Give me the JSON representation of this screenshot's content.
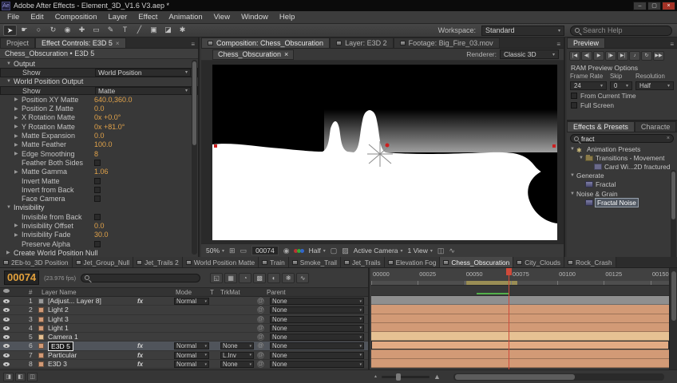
{
  "ui": {
    "caret": "▾",
    "caret_big": "▼",
    "menu": "≡",
    "close": "×",
    "pickwhip": "@",
    "mountain": "▲"
  },
  "colors": {
    "value_text": "#e0a24a",
    "layer_bar": "#d29a76",
    "camera_bar": "#e6c193",
    "adjustment_bar": "#8f8f8f",
    "cti": "#d04a3a",
    "cached": "#53b04a"
  },
  "titlebar": {
    "title": "Adobe After Effects - Element_3D_V1.6 V3.aep *",
    "app_initials": "Ae",
    "minimize": "–",
    "maximize": "▢",
    "close": "×"
  },
  "menubar": {
    "items": [
      "File",
      "Edit",
      "Composition",
      "Layer",
      "Effect",
      "Animation",
      "View",
      "Window",
      "Help"
    ]
  },
  "toolbar": {
    "tools": [
      {
        "name": "selection-tool-icon",
        "glyph": "➤"
      },
      {
        "name": "hand-tool-icon",
        "glyph": "☛"
      },
      {
        "name": "zoom-tool-icon",
        "glyph": "○"
      },
      {
        "name": "rotation-tool-icon",
        "glyph": "↻"
      },
      {
        "name": "unified-camera-tool-icon",
        "glyph": "◉"
      },
      {
        "name": "pan-behind-tool-icon",
        "glyph": "✚"
      },
      {
        "name": "mask-shape-tool-icon",
        "glyph": "▭"
      },
      {
        "name": "pen-tool-icon",
        "glyph": "✎"
      },
      {
        "name": "type-tool-icon",
        "glyph": "T"
      },
      {
        "name": "brush-tool-icon",
        "glyph": "╱"
      },
      {
        "name": "clone-stamp-tool-icon",
        "glyph": "▣"
      },
      {
        "name": "eraser-tool-icon",
        "glyph": "◪"
      },
      {
        "name": "puppet-pin-tool-icon",
        "glyph": "✱"
      }
    ],
    "workspace_label": "Workspace:",
    "workspace_value": "Standard",
    "search_placeholder": "Search Help"
  },
  "effect_controls": {
    "tab_project": "Project",
    "tab_active": "Effect Controls: E3D 5",
    "breadcrumb": "Chess_Obscuration • E3D 5",
    "rows": [
      {
        "label": "Output",
        "type": "group",
        "ind": "i0",
        "twirl": "▼",
        "value": ""
      },
      {
        "label": "Show",
        "type": "dropdown",
        "ind": "i1",
        "twirl": "",
        "value": "World Position"
      },
      {
        "label": "World Position Output",
        "type": "group",
        "ind": "i0",
        "twirl": "▼",
        "value": ""
      },
      {
        "label": "Show",
        "type": "dropdown",
        "ind": "i1",
        "twirl": "",
        "value": "Matte"
      },
      {
        "label": "Position XY Matte",
        "type": "value",
        "ind": "i1",
        "twirl": "▶",
        "value": "640.0,360.0"
      },
      {
        "label": "Position Z Matte",
        "type": "value",
        "ind": "i1",
        "twirl": "▶",
        "value": "0.0"
      },
      {
        "label": "X Rotation Matte",
        "type": "value",
        "ind": "i1",
        "twirl": "▶",
        "value": "0x +0.0°"
      },
      {
        "label": "Y Rotation Matte",
        "type": "value",
        "ind": "i1",
        "twirl": "▶",
        "value": "0x +81.0°"
      },
      {
        "label": "Matte Expansion",
        "type": "value",
        "ind": "i1",
        "twirl": "▶",
        "value": "0.0"
      },
      {
        "label": "Matte Feather",
        "type": "value",
        "ind": "i1",
        "twirl": "▶",
        "value": "100.0"
      },
      {
        "label": "Edge Smoothing",
        "type": "value",
        "ind": "i1",
        "twirl": "▶",
        "value": "8"
      },
      {
        "label": "Feather Both Sides",
        "type": "check",
        "ind": "i1",
        "twirl": "",
        "value": ""
      },
      {
        "label": "Matte Gamma",
        "type": "value",
        "ind": "i1",
        "twirl": "▶",
        "value": "1.06"
      },
      {
        "label": "Invert Matte",
        "type": "check",
        "ind": "i1",
        "twirl": "",
        "value": ""
      },
      {
        "label": "Invert from Back",
        "type": "check",
        "ind": "i1",
        "twirl": "",
        "value": ""
      },
      {
        "label": "Face Camera",
        "type": "check",
        "ind": "i1",
        "twirl": "",
        "value": ""
      },
      {
        "label": "Invisibility",
        "type": "group",
        "ind": "i0",
        "twirl": "▼",
        "value": ""
      },
      {
        "label": "Invisible from Back",
        "type": "check",
        "ind": "i1",
        "twirl": "",
        "value": ""
      },
      {
        "label": "Invisibility Offset",
        "type": "value",
        "ind": "i1",
        "twirl": "▶",
        "value": "0.0"
      },
      {
        "label": "Invisibility Fade",
        "type": "value",
        "ind": "i1",
        "twirl": "▶",
        "value": "30.0"
      },
      {
        "label": "Preserve Alpha",
        "type": "check",
        "ind": "i1",
        "twirl": "",
        "value": ""
      },
      {
        "label": "Create World Position Null",
        "type": "group",
        "ind": "i0",
        "twirl": "▶",
        "value": ""
      }
    ]
  },
  "composition": {
    "tabs": [
      {
        "label": "Composition: Chess_Obscuration",
        "active": "on"
      },
      {
        "label": "Layer: E3D 2",
        "active": ""
      },
      {
        "label": "Footage: Big_Fire_03.mov",
        "active": ""
      }
    ],
    "viewer_tab": "Chess_Obscuration",
    "renderer_label": "Renderer:",
    "renderer_value": "Classic 3D",
    "bottom": {
      "zoom": "50%",
      "grid_icon": "⊞",
      "mask_icon": "▭",
      "timecode": "00074",
      "snapshot_icon": "◉",
      "resolution": "Half",
      "roi_icon": "▢",
      "transparency_icon": "▨",
      "camera": "Active Camera",
      "views": "1 View",
      "pixel_aspect_icon": "◫",
      "fast_preview_icon": "∿"
    }
  },
  "preview": {
    "tab": "Preview",
    "buttons": [
      {
        "name": "first-frame-button",
        "glyph": "|◀"
      },
      {
        "name": "previous-frame-button",
        "glyph": "◀|"
      },
      {
        "name": "play-button",
        "glyph": "▶"
      },
      {
        "name": "next-frame-button",
        "glyph": "|▶"
      },
      {
        "name": "last-frame-button",
        "glyph": "▶|"
      },
      {
        "name": "audio-button",
        "glyph": "♪"
      },
      {
        "name": "loop-button",
        "glyph": "↻"
      },
      {
        "name": "ram-preview-button",
        "glyph": "▶▶"
      }
    ],
    "options_title": "RAM Preview Options",
    "frame_rate_label": "Frame Rate",
    "frame_rate_value": "24",
    "skip_label": "Skip",
    "skip_value": "0",
    "resolution_label": "Resolution",
    "resolution_value": "Half",
    "from_current_time_label": "From Current Time",
    "full_screen_label": "Full Screen"
  },
  "effects_presets": {
    "tab": "Effects & Presets",
    "tab_partial": "Characte",
    "search_value": "fract",
    "tree": [
      {
        "label": "Animation Presets",
        "ind": "t0",
        "twirl": "▼",
        "icon": "presets",
        "sel": ""
      },
      {
        "label": "Transitions - Movement",
        "ind": "t1",
        "twirl": "▼",
        "icon": "folder",
        "sel": ""
      },
      {
        "label": "Card Wi...2D fractured",
        "ind": "t2",
        "twirl": "",
        "icon": "preset",
        "sel": ""
      },
      {
        "label": "Generate",
        "ind": "t0",
        "twirl": "▼",
        "icon": "none",
        "sel": ""
      },
      {
        "label": "Fractal",
        "ind": "t1",
        "twirl": "",
        "icon": "effect",
        "sel": ""
      },
      {
        "label": "Noise & Grain",
        "ind": "t0",
        "twirl": "▼",
        "icon": "none",
        "sel": ""
      },
      {
        "label": "Fractal Noise",
        "ind": "t1",
        "twirl": "",
        "icon": "effect",
        "sel": "sel"
      }
    ]
  },
  "comp_tabs": {
    "items": [
      {
        "label": "2Eb-to_3D Position",
        "active": ""
      },
      {
        "label": "Jet_Group_Null",
        "active": ""
      },
      {
        "label": "Jet_Trails 2",
        "active": ""
      },
      {
        "label": "World Position Matte",
        "active": ""
      },
      {
        "label": "Train",
        "active": ""
      },
      {
        "label": "Smoke_Trail",
        "active": ""
      },
      {
        "label": "Jet_Trails",
        "active": ""
      },
      {
        "label": "Elevation Fog",
        "active": ""
      },
      {
        "label": "Chess_Obscuration",
        "active": "on"
      },
      {
        "label": "City_Clouds",
        "active": ""
      },
      {
        "label": "Rock_Crash",
        "active": ""
      }
    ]
  },
  "timeline": {
    "timecode": "00074",
    "fps": "(23.976 fps)",
    "headers": {
      "number": "#",
      "layer_name": "Layer Name",
      "mode": "Mode",
      "t": "T",
      "trkmat": "TrkMat",
      "parent": "Parent"
    },
    "view_icons": [
      {
        "name": "comp-mini-flowchart-icon",
        "glyph": "◱"
      },
      {
        "name": "draft-3d-icon",
        "glyph": "▦"
      },
      {
        "name": "hide-shy-layers-icon",
        "glyph": "◔"
      },
      {
        "name": "frame-blending-icon",
        "glyph": "▩"
      },
      {
        "name": "motion-blur-icon",
        "glyph": "◐"
      },
      {
        "name": "brainstorm-icon",
        "glyph": "❋"
      },
      {
        "name": "graph-editor-icon",
        "glyph": "∿"
      }
    ],
    "layers": [
      {
        "num": "1",
        "name": "[Adjust... Layer 8]",
        "mode": "Normal",
        "mode_vis": "show",
        "trkmat": "",
        "trkmat_vis": "",
        "parent": "None",
        "chip": "#9a9a9a",
        "bar": "#8f8f8f",
        "fx": "fx",
        "sel": "",
        "edit": ""
      },
      {
        "num": "2",
        "name": "Light 2",
        "mode": "",
        "mode_vis": "",
        "trkmat": "",
        "trkmat_vis": "",
        "parent": "None",
        "chip": "#d29a76",
        "bar": "#d29a76",
        "fx": "",
        "sel": "",
        "edit": ""
      },
      {
        "num": "3",
        "name": "Light 3",
        "mode": "",
        "mode_vis": "",
        "trkmat": "",
        "trkmat_vis": "",
        "parent": "None",
        "chip": "#d29a76",
        "bar": "#d29a76",
        "fx": "",
        "sel": "",
        "edit": ""
      },
      {
        "num": "4",
        "name": "Light 1",
        "mode": "",
        "mode_vis": "",
        "trkmat": "",
        "trkmat_vis": "",
        "parent": "None",
        "chip": "#d29a76",
        "bar": "#d29a76",
        "fx": "",
        "sel": "",
        "edit": ""
      },
      {
        "num": "5",
        "name": "Camera 1",
        "mode": "",
        "mode_vis": "",
        "trkmat": "",
        "trkmat_vis": "",
        "parent": "None",
        "chip": "#e6c193",
        "bar": "#e6c193",
        "fx": "",
        "sel": "",
        "edit": ""
      },
      {
        "num": "6",
        "name": "E3D 5",
        "mode": "Normal",
        "mode_vis": "show",
        "trkmat": "None",
        "trkmat_vis": "show",
        "parent": "None",
        "chip": "#d29a76",
        "bar": "#e2ab83",
        "fx": "fx",
        "sel": "sel",
        "edit": "edit"
      },
      {
        "num": "7",
        "name": "Particular",
        "mode": "Normal",
        "mode_vis": "show",
        "trkmat": "L.Inv",
        "trkmat_vis": "show",
        "parent": "None",
        "chip": "#d29a76",
        "bar": "#d29a76",
        "fx": "fx",
        "sel": "",
        "edit": ""
      },
      {
        "num": "8",
        "name": "E3D 3",
        "mode": "Normal",
        "mode_vis": "show",
        "trkmat": "None",
        "trkmat_vis": "show",
        "parent": "None",
        "chip": "#d29a76",
        "bar": "#d29a76",
        "fx": "fx",
        "sel": "",
        "edit": ""
      }
    ],
    "ruler": [
      {
        "label": "00000",
        "pos": "0%"
      },
      {
        "label": "00025",
        "pos": "15.6%"
      },
      {
        "label": "00050",
        "pos": "31.3%"
      },
      {
        "label": "00075",
        "pos": "46.9%"
      },
      {
        "label": "00100",
        "pos": "62.5%"
      },
      {
        "label": "00125",
        "pos": "78.1%"
      },
      {
        "label": "00150",
        "pos": "93.8%"
      }
    ],
    "cti_pos": "46.2%",
    "work_area": {
      "start": "32%",
      "w": "17%"
    },
    "cached": {
      "start": "35.5%",
      "w": "10.7%"
    }
  },
  "bottombar": {
    "icons": [
      {
        "name": "expand-layer-switches-icon",
        "glyph": "◨"
      },
      {
        "name": "expand-transfer-controls-icon",
        "glyph": "◧"
      },
      {
        "name": "expand-in-out-columns-icon",
        "glyph": "◫"
      }
    ]
  }
}
